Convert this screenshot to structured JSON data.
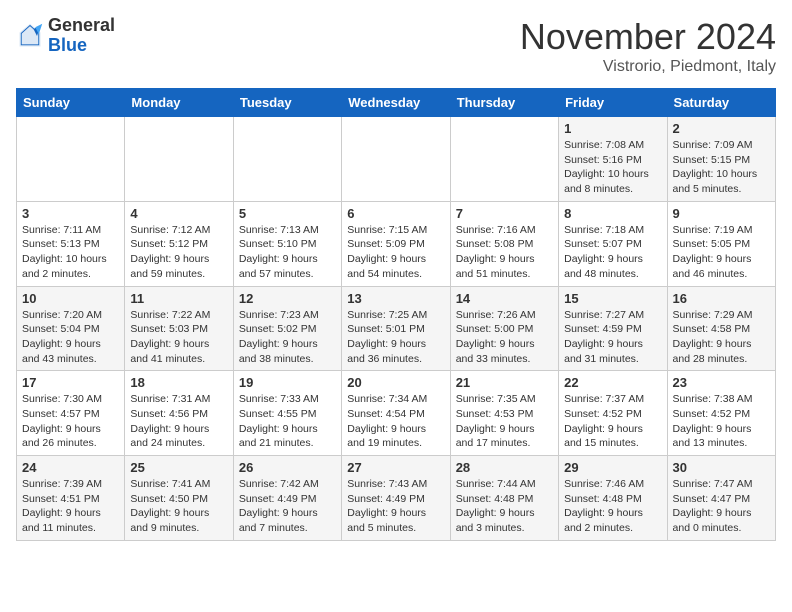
{
  "header": {
    "logo": {
      "general": "General",
      "blue": "Blue"
    },
    "title": "November 2024",
    "subtitle": "Vistrorio, Piedmont, Italy"
  },
  "days_of_week": [
    "Sunday",
    "Monday",
    "Tuesday",
    "Wednesday",
    "Thursday",
    "Friday",
    "Saturday"
  ],
  "weeks": [
    [
      null,
      null,
      null,
      null,
      null,
      {
        "day": "1",
        "sunrise": "Sunrise: 7:08 AM",
        "sunset": "Sunset: 5:16 PM",
        "daylight": "Daylight: 10 hours and 8 minutes."
      },
      {
        "day": "2",
        "sunrise": "Sunrise: 7:09 AM",
        "sunset": "Sunset: 5:15 PM",
        "daylight": "Daylight: 10 hours and 5 minutes."
      }
    ],
    [
      {
        "day": "3",
        "sunrise": "Sunrise: 7:11 AM",
        "sunset": "Sunset: 5:13 PM",
        "daylight": "Daylight: 10 hours and 2 minutes."
      },
      {
        "day": "4",
        "sunrise": "Sunrise: 7:12 AM",
        "sunset": "Sunset: 5:12 PM",
        "daylight": "Daylight: 9 hours and 59 minutes."
      },
      {
        "day": "5",
        "sunrise": "Sunrise: 7:13 AM",
        "sunset": "Sunset: 5:10 PM",
        "daylight": "Daylight: 9 hours and 57 minutes."
      },
      {
        "day": "6",
        "sunrise": "Sunrise: 7:15 AM",
        "sunset": "Sunset: 5:09 PM",
        "daylight": "Daylight: 9 hours and 54 minutes."
      },
      {
        "day": "7",
        "sunrise": "Sunrise: 7:16 AM",
        "sunset": "Sunset: 5:08 PM",
        "daylight": "Daylight: 9 hours and 51 minutes."
      },
      {
        "day": "8",
        "sunrise": "Sunrise: 7:18 AM",
        "sunset": "Sunset: 5:07 PM",
        "daylight": "Daylight: 9 hours and 48 minutes."
      },
      {
        "day": "9",
        "sunrise": "Sunrise: 7:19 AM",
        "sunset": "Sunset: 5:05 PM",
        "daylight": "Daylight: 9 hours and 46 minutes."
      }
    ],
    [
      {
        "day": "10",
        "sunrise": "Sunrise: 7:20 AM",
        "sunset": "Sunset: 5:04 PM",
        "daylight": "Daylight: 9 hours and 43 minutes."
      },
      {
        "day": "11",
        "sunrise": "Sunrise: 7:22 AM",
        "sunset": "Sunset: 5:03 PM",
        "daylight": "Daylight: 9 hours and 41 minutes."
      },
      {
        "day": "12",
        "sunrise": "Sunrise: 7:23 AM",
        "sunset": "Sunset: 5:02 PM",
        "daylight": "Daylight: 9 hours and 38 minutes."
      },
      {
        "day": "13",
        "sunrise": "Sunrise: 7:25 AM",
        "sunset": "Sunset: 5:01 PM",
        "daylight": "Daylight: 9 hours and 36 minutes."
      },
      {
        "day": "14",
        "sunrise": "Sunrise: 7:26 AM",
        "sunset": "Sunset: 5:00 PM",
        "daylight": "Daylight: 9 hours and 33 minutes."
      },
      {
        "day": "15",
        "sunrise": "Sunrise: 7:27 AM",
        "sunset": "Sunset: 4:59 PM",
        "daylight": "Daylight: 9 hours and 31 minutes."
      },
      {
        "day": "16",
        "sunrise": "Sunrise: 7:29 AM",
        "sunset": "Sunset: 4:58 PM",
        "daylight": "Daylight: 9 hours and 28 minutes."
      }
    ],
    [
      {
        "day": "17",
        "sunrise": "Sunrise: 7:30 AM",
        "sunset": "Sunset: 4:57 PM",
        "daylight": "Daylight: 9 hours and 26 minutes."
      },
      {
        "day": "18",
        "sunrise": "Sunrise: 7:31 AM",
        "sunset": "Sunset: 4:56 PM",
        "daylight": "Daylight: 9 hours and 24 minutes."
      },
      {
        "day": "19",
        "sunrise": "Sunrise: 7:33 AM",
        "sunset": "Sunset: 4:55 PM",
        "daylight": "Daylight: 9 hours and 21 minutes."
      },
      {
        "day": "20",
        "sunrise": "Sunrise: 7:34 AM",
        "sunset": "Sunset: 4:54 PM",
        "daylight": "Daylight: 9 hours and 19 minutes."
      },
      {
        "day": "21",
        "sunrise": "Sunrise: 7:35 AM",
        "sunset": "Sunset: 4:53 PM",
        "daylight": "Daylight: 9 hours and 17 minutes."
      },
      {
        "day": "22",
        "sunrise": "Sunrise: 7:37 AM",
        "sunset": "Sunset: 4:52 PM",
        "daylight": "Daylight: 9 hours and 15 minutes."
      },
      {
        "day": "23",
        "sunrise": "Sunrise: 7:38 AM",
        "sunset": "Sunset: 4:52 PM",
        "daylight": "Daylight: 9 hours and 13 minutes."
      }
    ],
    [
      {
        "day": "24",
        "sunrise": "Sunrise: 7:39 AM",
        "sunset": "Sunset: 4:51 PM",
        "daylight": "Daylight: 9 hours and 11 minutes."
      },
      {
        "day": "25",
        "sunrise": "Sunrise: 7:41 AM",
        "sunset": "Sunset: 4:50 PM",
        "daylight": "Daylight: 9 hours and 9 minutes."
      },
      {
        "day": "26",
        "sunrise": "Sunrise: 7:42 AM",
        "sunset": "Sunset: 4:49 PM",
        "daylight": "Daylight: 9 hours and 7 minutes."
      },
      {
        "day": "27",
        "sunrise": "Sunrise: 7:43 AM",
        "sunset": "Sunset: 4:49 PM",
        "daylight": "Daylight: 9 hours and 5 minutes."
      },
      {
        "day": "28",
        "sunrise": "Sunrise: 7:44 AM",
        "sunset": "Sunset: 4:48 PM",
        "daylight": "Daylight: 9 hours and 3 minutes."
      },
      {
        "day": "29",
        "sunrise": "Sunrise: 7:46 AM",
        "sunset": "Sunset: 4:48 PM",
        "daylight": "Daylight: 9 hours and 2 minutes."
      },
      {
        "day": "30",
        "sunrise": "Sunrise: 7:47 AM",
        "sunset": "Sunset: 4:47 PM",
        "daylight": "Daylight: 9 hours and 0 minutes."
      }
    ]
  ]
}
